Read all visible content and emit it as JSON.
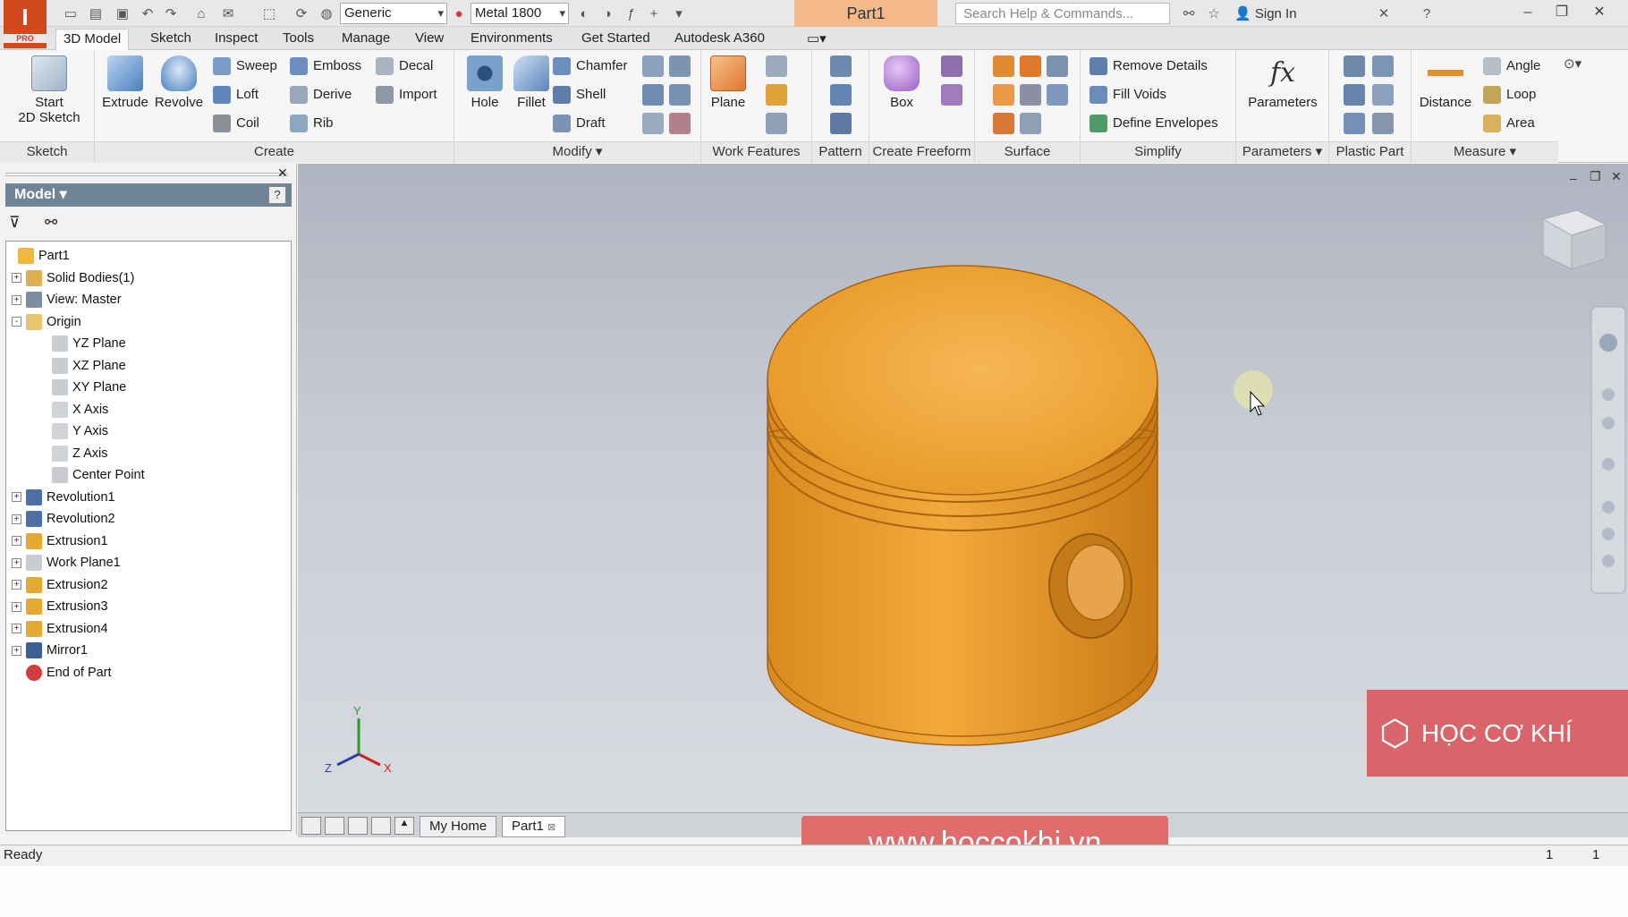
{
  "app": {
    "logo_text": "I",
    "logo_sub": "PRO",
    "document": "Part1",
    "search_placeholder": "Search Help & Commands...",
    "sign_in": "Sign In"
  },
  "quick_access": {
    "appearance": "Generic",
    "material": "Metal 1800"
  },
  "ribbon_tabs": [
    "3D Model",
    "Sketch",
    "Inspect",
    "Tools",
    "Manage",
    "View",
    "Environments",
    "Get Started",
    "Autodesk A360"
  ],
  "ribbon": {
    "sketch": {
      "title": "Sketch",
      "start_sketch": "Start",
      "start_sketch_2": "2D Sketch"
    },
    "create": {
      "title": "Create",
      "extrude": "Extrude",
      "revolve": "Revolve",
      "sweep": "Sweep",
      "loft": "Loft",
      "coil": "Coil",
      "emboss": "Emboss",
      "derive": "Derive",
      "rib": "Rib",
      "decal": "Decal",
      "import": "Import"
    },
    "modify": {
      "title": "Modify",
      "hole": "Hole",
      "fillet": "Fillet",
      "chamfer": "Chamfer",
      "shell": "Shell",
      "draft": "Draft"
    },
    "work_features": {
      "title": "Work Features",
      "plane": "Plane"
    },
    "pattern": {
      "title": "Pattern"
    },
    "create_freeform": {
      "title": "Create Freeform",
      "box": "Box"
    },
    "surface": {
      "title": "Surface"
    },
    "simplify": {
      "title": "Simplify",
      "remove_details": "Remove Details",
      "fill_voids": "Fill Voids",
      "define_envelopes": "Define Envelopes"
    },
    "parameters": {
      "title": "Parameters",
      "parameters": "Parameters",
      "fx": "fx"
    },
    "plastic_part": {
      "title": "Plastic Part"
    },
    "measure": {
      "title": "Measure",
      "distance": "Distance",
      "angle": "Angle",
      "loop": "Loop",
      "area": "Area"
    }
  },
  "browser": {
    "title": "Model",
    "help": "?",
    "tree": [
      {
        "label": "Part1",
        "level": 0,
        "expander": "",
        "icon": "part-icon"
      },
      {
        "label": "Solid Bodies(1)",
        "level": 1,
        "expander": "+",
        "icon": "solid-bodies-icon"
      },
      {
        "label": "View: Master",
        "level": 1,
        "expander": "+",
        "icon": "view-icon"
      },
      {
        "label": "Origin",
        "level": 1,
        "expander": "-",
        "icon": "folder-icon"
      },
      {
        "label": "YZ Plane",
        "level": 2,
        "expander": "",
        "icon": "plane-icon"
      },
      {
        "label": "XZ Plane",
        "level": 2,
        "expander": "",
        "icon": "plane-icon"
      },
      {
        "label": "XY Plane",
        "level": 2,
        "expander": "",
        "icon": "plane-icon"
      },
      {
        "label": "X Axis",
        "level": 2,
        "expander": "",
        "icon": "axis-icon"
      },
      {
        "label": "Y Axis",
        "level": 2,
        "expander": "",
        "icon": "axis-icon"
      },
      {
        "label": "Z Axis",
        "level": 2,
        "expander": "",
        "icon": "axis-icon"
      },
      {
        "label": "Center Point",
        "level": 2,
        "expander": "",
        "icon": "point-icon"
      },
      {
        "label": "Revolution1",
        "level": 1,
        "expander": "+",
        "icon": "revolve-icon"
      },
      {
        "label": "Revolution2",
        "level": 1,
        "expander": "+",
        "icon": "revolve-icon"
      },
      {
        "label": "Extrusion1",
        "level": 1,
        "expander": "+",
        "icon": "extrude-icon"
      },
      {
        "label": "Work Plane1",
        "level": 1,
        "expander": "+",
        "icon": "plane-icon"
      },
      {
        "label": "Extrusion2",
        "level": 1,
        "expander": "+",
        "icon": "extrude-icon"
      },
      {
        "label": "Extrusion3",
        "level": 1,
        "expander": "+",
        "icon": "extrude-icon"
      },
      {
        "label": "Extrusion4",
        "level": 1,
        "expander": "+",
        "icon": "extrude-icon"
      },
      {
        "label": "Mirror1",
        "level": 1,
        "expander": "+",
        "icon": "mirror-icon"
      },
      {
        "label": "End of Part",
        "level": 1,
        "expander": "",
        "icon": "end-of-part-icon"
      }
    ]
  },
  "doc_tabs": {
    "home": "My Home",
    "part": "Part1"
  },
  "status": {
    "text": "Ready",
    "count1": "1",
    "count2": "1"
  },
  "triad": {
    "x": "X",
    "y": "Y",
    "z": "Z"
  },
  "overlays": {
    "website": "www.hoccokhi.vn",
    "brand": "HỌC CƠ KHÍ"
  },
  "colors": {
    "part": "#f0a030",
    "accent": "#d3491f",
    "browser_title": "#6f8597"
  }
}
